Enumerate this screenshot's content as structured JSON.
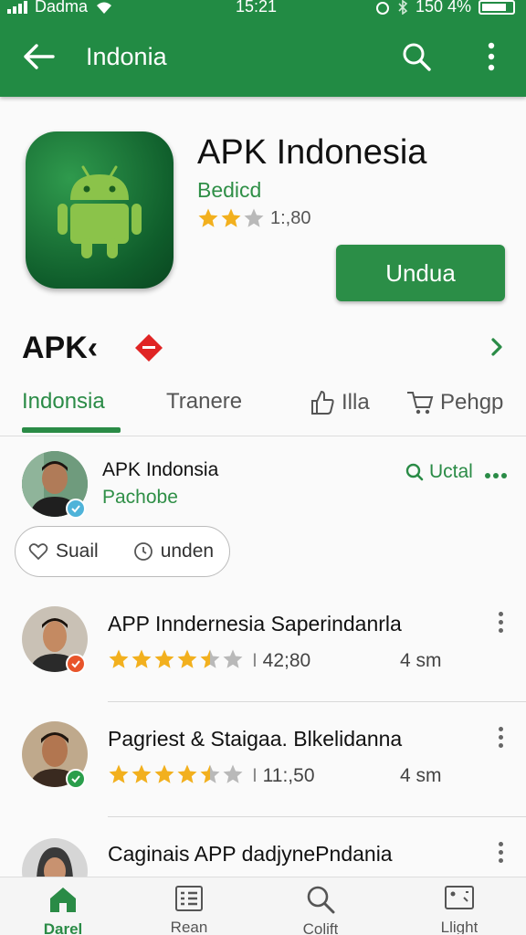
{
  "status": {
    "carrier": "Dadma",
    "time": "15:21",
    "battery": "150 4%"
  },
  "appbar": {
    "title": "Indonia"
  },
  "app": {
    "name": "APK Indonesia",
    "developer": "Bedicd",
    "rating_text": "1:,80",
    "rating_stars": 2,
    "install_label": "Undua"
  },
  "brand": {
    "text": "APK‹"
  },
  "tabs": [
    {
      "label": "Indonsia",
      "active": true
    },
    {
      "label": "Trаnere",
      "active": false
    },
    {
      "label": "Illa",
      "active": false
    },
    {
      "label": "Pehgp",
      "active": false
    }
  ],
  "post": {
    "name": "APK Indonsia",
    "sub": "Pachobe",
    "action_label": "Uctal",
    "chip_left": "Suail",
    "chip_right": "unden"
  },
  "reviews": [
    {
      "title": "APP Inndernesia Saperindanrla",
      "stars": 4.5,
      "count": "42;80",
      "age": "4 sm"
    },
    {
      "title": "Pagriest & Staigaa. Blkelidanna",
      "stars": 4.5,
      "count": "11:,50",
      "age": "4 sm"
    },
    {
      "title": "Caginais APP dadjynePndania",
      "stars": 0,
      "count": "",
      "age": ""
    }
  ],
  "nav": [
    {
      "label": "Darel",
      "icon": "home-icon",
      "active": true
    },
    {
      "label": "Rean",
      "icon": "list-icon",
      "active": false
    },
    {
      "label": "Colift",
      "icon": "search-icon",
      "active": false
    },
    {
      "label": "Llight",
      "icon": "image-icon",
      "active": false
    }
  ],
  "colors": {
    "primary": "#228b44",
    "accent": "#2a8b46",
    "star": "#f2b01e"
  }
}
